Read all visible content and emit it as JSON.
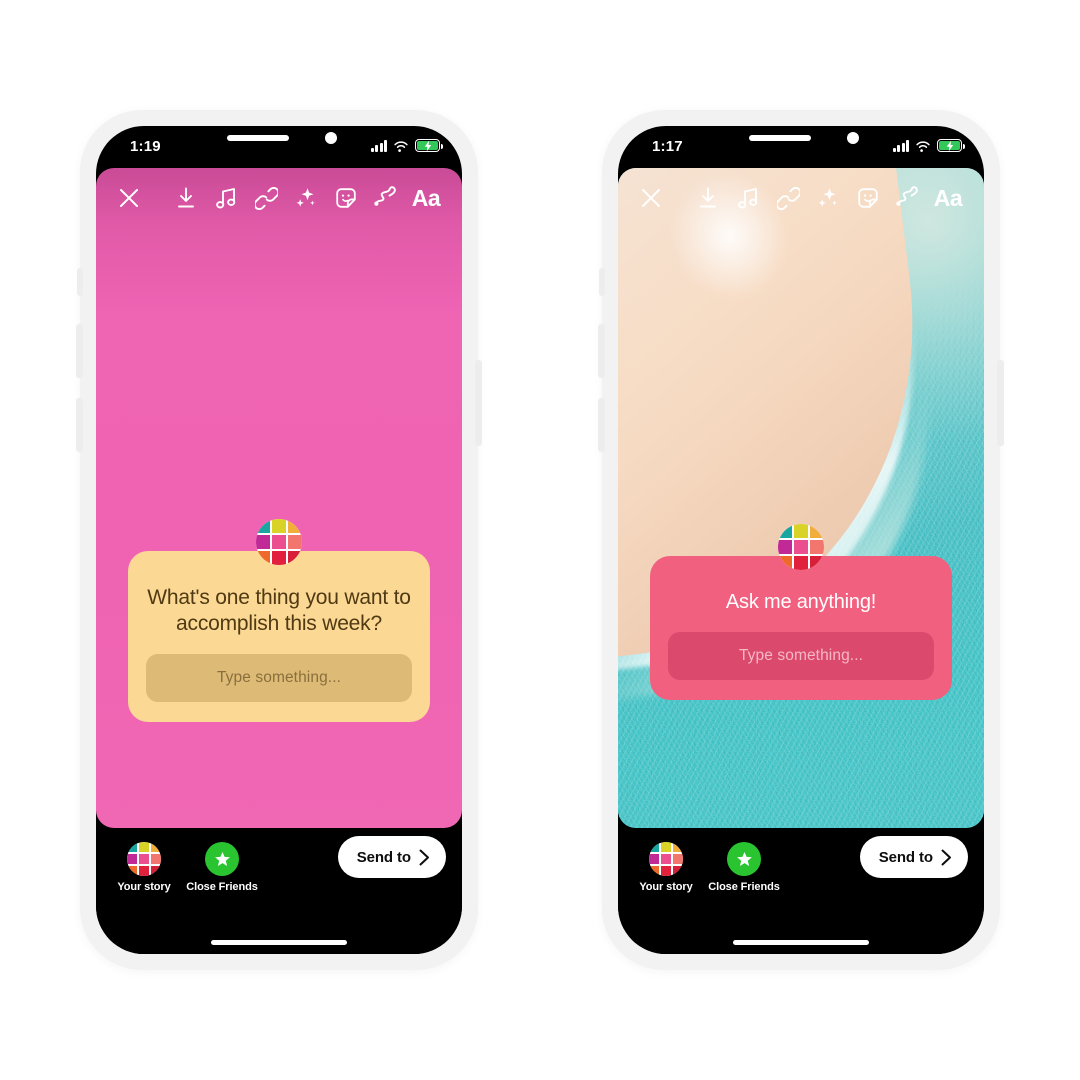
{
  "scene": {
    "background_color": "#ffffff",
    "description": "Two smartphone mockups showing Instagram Story question sticker composer"
  },
  "avatar_grid_colors": [
    "#19a6a0",
    "#d9d328",
    "#f2ae3a",
    "#c12a96",
    "#ec4f90",
    "#f2766e",
    "#ef6a2a",
    "#e0203c",
    "#d81f3a"
  ],
  "phones": [
    {
      "id": "phone-left",
      "status_bar": {
        "time": "1:19",
        "signal_icon": "cellular-bars-icon",
        "wifi_icon": "wifi-icon",
        "battery_icon": "battery-charging-icon",
        "battery_color": "#34c759"
      },
      "toolbar": {
        "close_label": "×",
        "items": [
          {
            "name": "close-icon",
            "label": "Close"
          },
          {
            "name": "download-icon",
            "label": "Save"
          },
          {
            "name": "music-icon",
            "label": "Music"
          },
          {
            "name": "link-icon",
            "label": "Link"
          },
          {
            "name": "sparkles-icon",
            "label": "Effects"
          },
          {
            "name": "sticker-icon",
            "label": "Stickers"
          },
          {
            "name": "draw-icon",
            "label": "Draw"
          },
          {
            "name": "text-icon",
            "label": "Aa"
          }
        ],
        "text_tool_label": "Aa"
      },
      "canvas": {
        "type": "solid-gradient",
        "background_color": "#ef64b4"
      },
      "sticker": {
        "question": "What's one thing you want to accomplish this week?",
        "answer_placeholder": "Type something...",
        "background_color": "#fbd894",
        "text_color": "#4f3a13",
        "input_background_color": "#ddbb77"
      },
      "bottom_bar": {
        "your_story_label": "Your story",
        "close_friends_label": "Close Friends",
        "close_friends_color": "#2ac431",
        "send_to_label": "Send to"
      }
    },
    {
      "id": "phone-right",
      "status_bar": {
        "time": "1:17",
        "signal_icon": "cellular-bars-icon",
        "wifi_icon": "wifi-icon",
        "battery_icon": "battery-charging-icon",
        "battery_color": "#34c759"
      },
      "toolbar": {
        "close_label": "×",
        "items": [
          {
            "name": "close-icon",
            "label": "Close"
          },
          {
            "name": "download-icon",
            "label": "Save"
          },
          {
            "name": "music-icon",
            "label": "Music"
          },
          {
            "name": "link-icon",
            "label": "Link"
          },
          {
            "name": "sparkles-icon",
            "label": "Effects"
          },
          {
            "name": "sticker-icon",
            "label": "Stickers"
          },
          {
            "name": "draw-icon",
            "label": "Draw"
          },
          {
            "name": "text-icon",
            "label": "Aa"
          }
        ],
        "text_tool_label": "Aa"
      },
      "canvas": {
        "type": "photo",
        "description": "Aerial beach photo: pale sand upper-left, turquoise ocean lower-right",
        "sand_color": "#f5dfcd",
        "water_color": "#33bec3"
      },
      "sticker": {
        "question": "Ask me anything!",
        "answer_placeholder": "Type something...",
        "background_color": "#f2607f",
        "text_color": "#ffffff",
        "input_background_color": "#db4a6c"
      },
      "bottom_bar": {
        "your_story_label": "Your story",
        "close_friends_label": "Close Friends",
        "close_friends_color": "#2ac431",
        "send_to_label": "Send to"
      }
    }
  ]
}
